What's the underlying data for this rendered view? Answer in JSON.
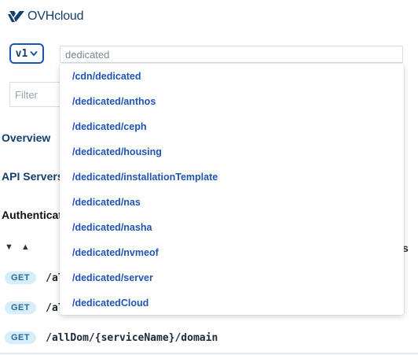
{
  "brand": {
    "name": "OVHcloud",
    "color": "#123f6d"
  },
  "version": {
    "selected": "v1",
    "icon": "chevron-down-icon"
  },
  "search": {
    "value": "dedicated"
  },
  "filter": {
    "placeholder": "Filter"
  },
  "sections": {
    "overview": "Overview",
    "api_servers": "API Servers",
    "authentication": "Authenticat"
  },
  "sort": {
    "desc_icon": "▼",
    "asc_icon": "▲"
  },
  "edge_char": "s",
  "endpoints": [
    {
      "method": "GET",
      "path": "/al"
    },
    {
      "method": "GET",
      "path": "/al"
    },
    {
      "method": "GET",
      "path": "/allDom/{serviceName}/domain"
    }
  ],
  "suggestions": [
    "/cdn/dedicated",
    "/dedicated/anthos",
    "/dedicated/ceph",
    "/dedicated/housing",
    "/dedicated/installationTemplate",
    "/dedicated/nas",
    "/dedicated/nasha",
    "/dedicated/nvmeof",
    "/dedicated/server",
    "/dedicatedCloud"
  ],
  "colors": {
    "accent": "#1a56b5",
    "link": "#1e55b4",
    "get_badge_bg": "#d7eefc"
  }
}
